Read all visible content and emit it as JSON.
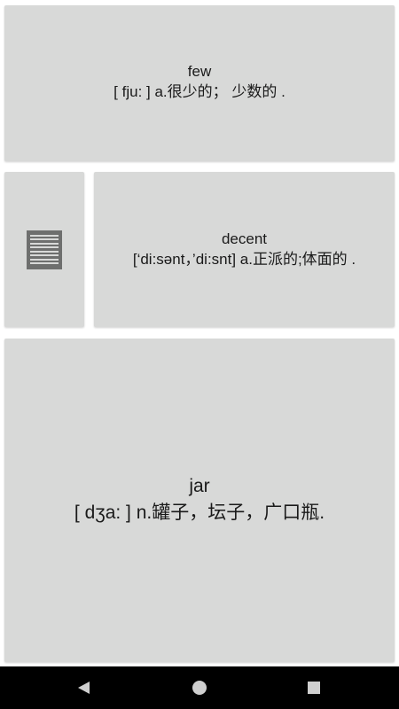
{
  "cards": [
    {
      "word": "few",
      "definition": "[ fju: ] a.很少的； 少数的 ."
    },
    {
      "word": "decent",
      "definition": "[‘di:sənt，’di:snt] a.正派的;体面的 ."
    },
    {
      "word": "jar",
      "definition": "[ dʒa: ] n.罐子，坛子，广口瓶."
    }
  ],
  "menu": {
    "icon": "list-icon"
  },
  "navbar": {
    "back_icon": "back-triangle-icon",
    "home_icon": "home-circle-icon",
    "recent_icon": "recent-square-icon"
  },
  "colors": {
    "card_bg": "#d8d9d8",
    "icon": "#6e6f6e",
    "navbar_bg": "#000000"
  }
}
